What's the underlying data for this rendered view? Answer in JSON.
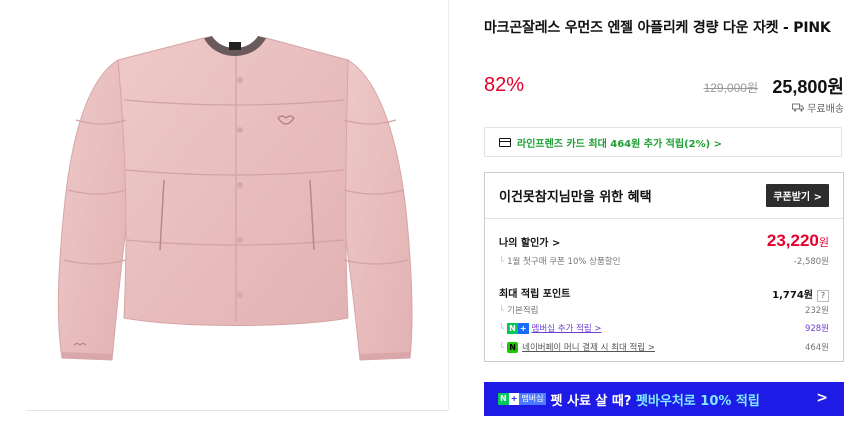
{
  "product": {
    "title": "마크곤잘레스 우먼즈 엔젤 아플리케 경량 다운 자켓 - PINK",
    "discount": "82%",
    "original_price": "129,000원",
    "sale_price": "25,800원",
    "shipping": "무료배송"
  },
  "card_banner": {
    "text": "라인프렌즈 카드 최대 464원 추가 적립(2%) >"
  },
  "benefits": {
    "title": "이건못참지님만을 위한 혜택",
    "coupon_button": "쿠폰받기 >",
    "my_price_label": "나의 할인가 >",
    "my_price_value": "23,220",
    "my_price_unit": "원",
    "coupon_detail": "1월 첫구매 쿠폰 10% 상품할인",
    "coupon_detail_value": "-2,580원",
    "points_label": "최대 적립 포인트",
    "points_value": "1,774원",
    "points_help": "?",
    "basic_label": "기본적립",
    "basic_value": "232원",
    "membership_label": "멤버십 추가 적립 >",
    "membership_value": "928원",
    "npay_label": "네이버페이 머니 결제 시 최대 적립 >",
    "npay_value": "464원"
  },
  "cta": {
    "badge_n": "N",
    "badge_plus": "+",
    "badge_membership": "멤버십",
    "text_main": "펫 사료 살 때?",
    "text_highlight": " 펫바우처로 10% 적립",
    "arrow": ">"
  },
  "colors": {
    "accent_red": "#e4002b",
    "naver_green": "#03c75a",
    "cta_blue": "#1d1be5",
    "membership_purple": "#6c3fd0"
  }
}
